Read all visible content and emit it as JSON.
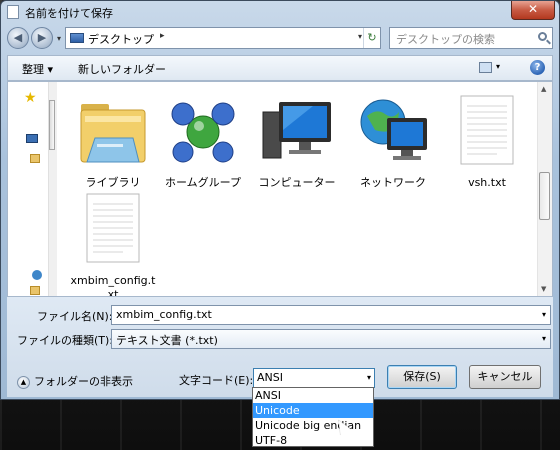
{
  "window": {
    "title": "名前を付けて保存",
    "close_label": "✕"
  },
  "nav": {
    "back_label": "◀",
    "forward_label": "▶",
    "dropdown_label": "▾",
    "address_text": "デスクトップ",
    "address_arrow": "▸",
    "address_dropdown": "▾",
    "refresh_label": "↻",
    "search_placeholder": "デスクトップの検索"
  },
  "toolbar": {
    "organize_label": "整理 ▾",
    "new_folder_label": "新しいフォルダー",
    "view_dropdown": "▾",
    "help_label": "?"
  },
  "items": [
    {
      "label": "ライブラリ",
      "icon": "library-folder-icon"
    },
    {
      "label": "ホームグループ",
      "icon": "homegroup-icon"
    },
    {
      "label": "コンピューター",
      "icon": "computer-icon"
    },
    {
      "label": "ネットワーク",
      "icon": "network-icon"
    },
    {
      "label": "vsh.txt",
      "icon": "text-file-icon"
    },
    {
      "label": "xmbim_config.txt",
      "label_line1": "xmbim_config.t",
      "label_line2": "xt",
      "icon": "text-file-icon"
    }
  ],
  "form": {
    "filename_label": "ファイル名(N):",
    "filename_value": "xmbim_config.txt",
    "filetype_label": "ファイルの種類(T):",
    "filetype_value": "テキスト文書 (*.txt)",
    "hide_folders_label": "フォルダーの非表示",
    "encoding_label": "文字コード(E):",
    "encoding_value": "ANSI",
    "save_label": "保存(S)",
    "cancel_label": "キャンセル"
  },
  "encoding_options": [
    "ANSI",
    "Unicode",
    "Unicode big endian",
    "UTF-8"
  ],
  "encoding_highlighted": "Unicode"
}
